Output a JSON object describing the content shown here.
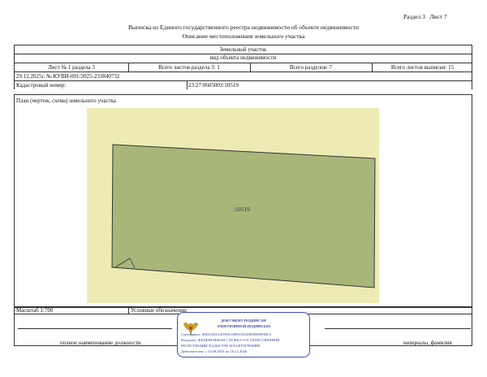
{
  "header": {
    "section": "Раздел 3",
    "sheet": "Лист 7",
    "title": "Выписка из Единого государственного реестра недвижимости об объекте недвижимости",
    "subtitle": "Описание местоположения земельного участка"
  },
  "object": {
    "type": "Земельный участок",
    "type_caption": "вид объекта недвижимости"
  },
  "sheet_info": {
    "sheet_section": "Лист № 1 раздела 3",
    "total_sheets_section": "Всего листов раздела 3: 1",
    "total_sections": "Всего разделов: 7",
    "total_sheets": "Всего листов выписки: 15"
  },
  "doc": {
    "date_number": "29.12.2025г. № КУВИ-001/2025-233840732",
    "cadastral_label": "Кадастровый номер:",
    "cadastral_value": "23:27:0605003:10519"
  },
  "plan": {
    "label": "План (чертеж, схема) земельного участка",
    "parcel_label": ":10519",
    "colors": {
      "background": "#eeeab4",
      "parcel": "#a9b67a",
      "outline": "#333333"
    }
  },
  "footer": {
    "scale": "Масштаб 1:700",
    "legend": "Условные обозначения:",
    "position_label": "полное наименование должности",
    "name_label": "инициалы, фамилия"
  },
  "signature": {
    "line1": "ДОКУМЕНТ ПОДПИСАН",
    "line2": "ЭЛЕКТРОННОЙ ПОДПИСЬЮ",
    "line3": "Сертификат: 00E4AD4A45993C6FB19A3D0E8B0FFDEA",
    "line4": "Владелец: ФЕДЕРАЛЬНАЯ СЛУЖБА ГОСУДАРСТВЕННОЙ",
    "line5": "РЕГИСТРАЦИИ, КАДАСТРА И КАРТОГРАФИИ",
    "line6": "Действителен: с 15.09.2025 по 10.12.2026",
    "color": "#2d3f9a",
    "emblem_icon": "eagle-emblem-icon"
  }
}
